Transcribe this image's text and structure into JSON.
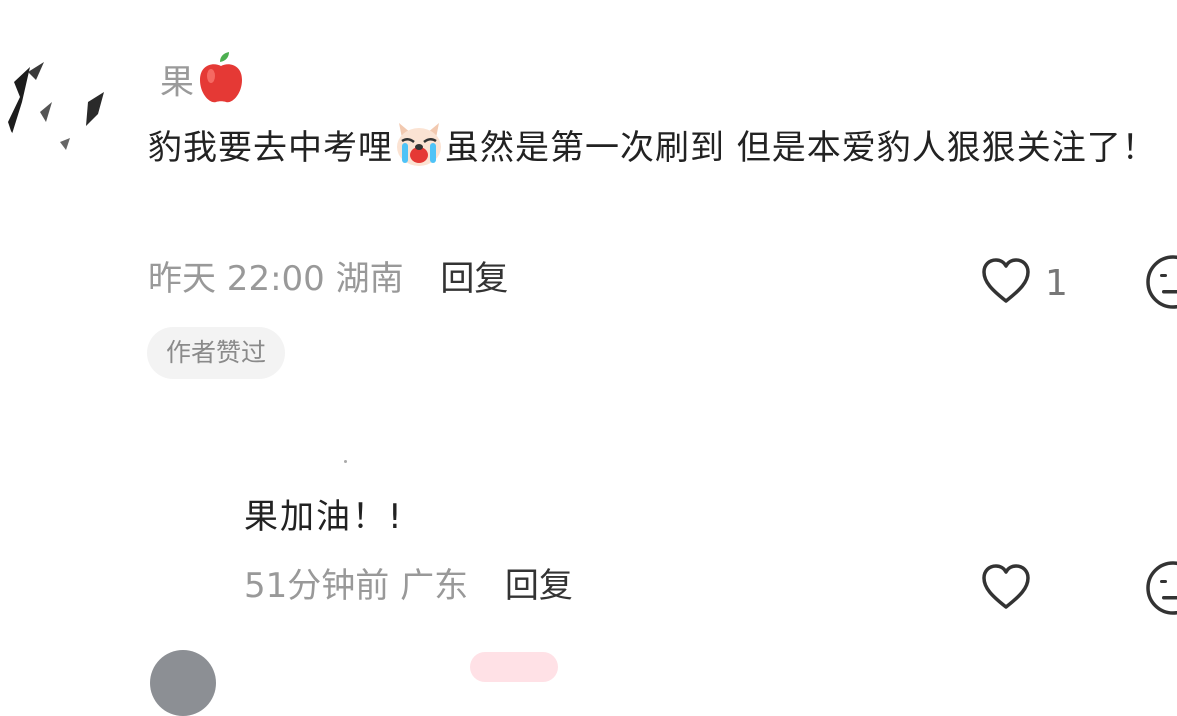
{
  "comments": [
    {
      "username": "果",
      "username_emoji": "apple-icon",
      "text_before_emoji": "豹我要去中考哩",
      "inline_emoji": "crying-dog-icon",
      "text_after_emoji": "虽然是第一次刷到 但是本爱豹人狠狠关注了！",
      "time": "昨天 22:00",
      "location": "湖南",
      "reply_label": "回复",
      "like_count": "1",
      "badge": "作者赞过"
    }
  ],
  "replies": [
    {
      "text": "果加油！!",
      "time": "51分钟前",
      "location": "广东",
      "reply_label": "回复"
    }
  ],
  "colors": {
    "meta": "#999999",
    "text": "#222222",
    "badge_bg": "#f3f3f3",
    "heart": "#333333",
    "pill": "#ffe1e6"
  }
}
